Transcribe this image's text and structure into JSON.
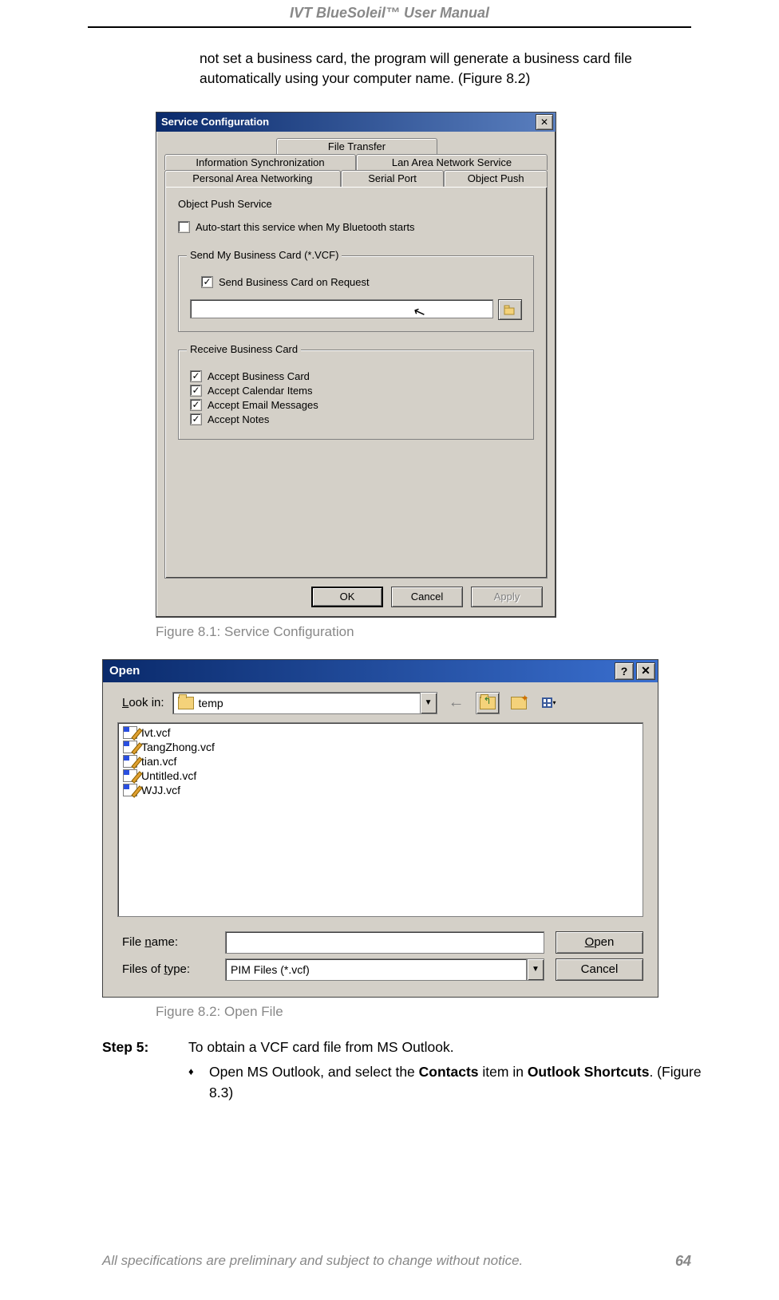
{
  "header": {
    "title": "IVT BlueSoleil™ User Manual"
  },
  "intro": "not set a business card, the program will generate a business card file automatically using your computer name. (Figure 8.2)",
  "dlg1": {
    "title": "Service Configuration",
    "tabs_row1": [
      "File Transfer"
    ],
    "tabs_row2": [
      "Information Synchronization",
      "Lan Area Network Service"
    ],
    "tabs_row3": [
      "Personal Area Networking",
      "Serial Port",
      "Object Push"
    ],
    "section_label": "Object Push Service",
    "autostart": "Auto-start this service when My Bluetooth starts",
    "grp_send": {
      "legend": "Send My Business Card (*.VCF)",
      "chk": "Send Business Card on Request"
    },
    "grp_recv": {
      "legend": "Receive Business Card",
      "items": [
        "Accept Business Card",
        "Accept Calendar Items",
        "Accept Email Messages",
        "Accept Notes"
      ]
    },
    "buttons": {
      "ok": "OK",
      "cancel": "Cancel",
      "apply": "Apply"
    }
  },
  "caption1": "Figure 8.1: Service Configuration",
  "dlg2": {
    "title": "Open",
    "lookin_label": "Look in:",
    "lookin_value": "temp",
    "files": [
      "Ivt.vcf",
      "TangZhong.vcf",
      "tian.vcf",
      "Untitled.vcf",
      "WJJ.vcf"
    ],
    "filename_label": "File name:",
    "filename_value": "",
    "filetype_label": "Files of type:",
    "filetype_value": "PIM Files (*.vcf)",
    "buttons": {
      "open": "Open",
      "cancel": "Cancel"
    }
  },
  "caption2": "Figure 8.2: Open File",
  "step5": {
    "label": "Step 5:",
    "line1": "To obtain a VCF card file from MS Outlook.",
    "bullet_pre": "Open MS Outlook, and select the ",
    "bullet_b1": "Contacts",
    "bullet_mid": " item in ",
    "bullet_b2": "Outlook Shortcuts",
    "bullet_post": ". (Figure 8.3)"
  },
  "footer": {
    "text": "All specifications are preliminary and subject to change without notice.",
    "num": "64"
  }
}
